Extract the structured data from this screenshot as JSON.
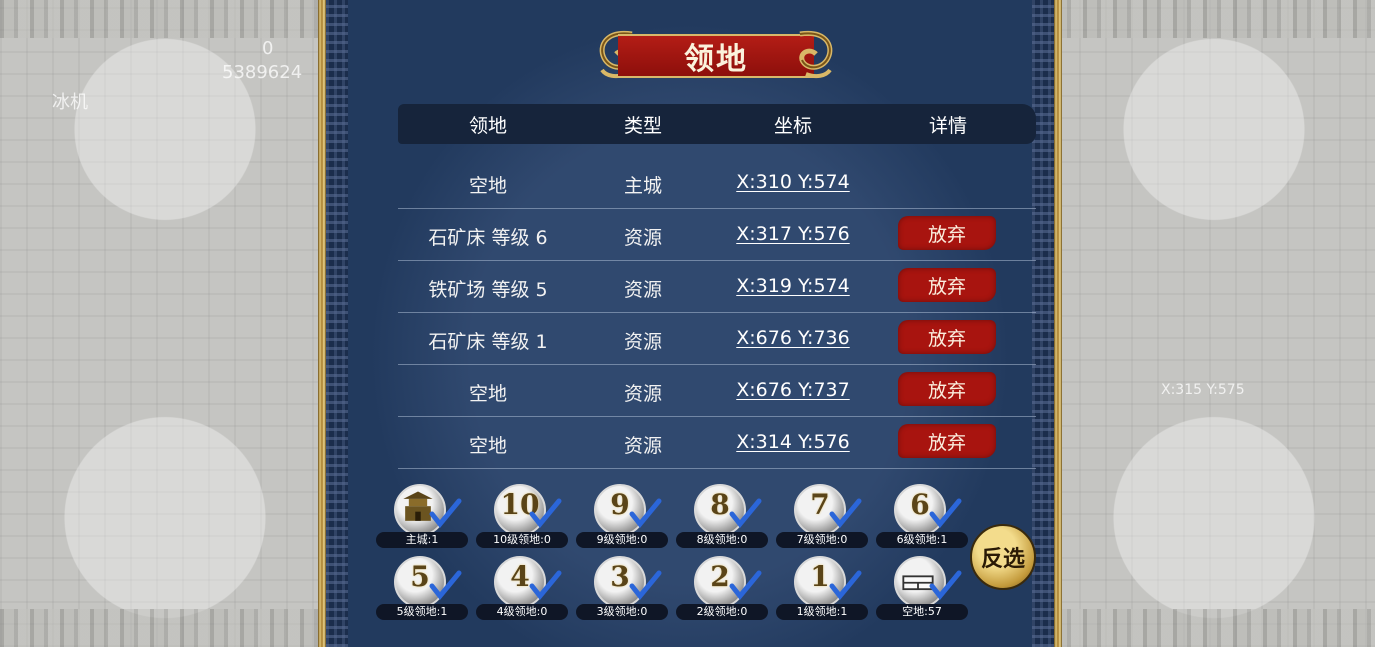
{
  "title": "领地",
  "table": {
    "headers": {
      "name": "领地",
      "type": "类型",
      "coord": "坐标",
      "detail": "详情"
    },
    "rows": [
      {
        "name": "空地",
        "type": "主城",
        "coord": "X:310 Y:574",
        "action": ""
      },
      {
        "name": "石矿床 等级 6",
        "type": "资源",
        "coord": "X:317 Y:576",
        "action": "放弃"
      },
      {
        "name": "铁矿场 等级 5",
        "type": "资源",
        "coord": "X:319 Y:574",
        "action": "放弃"
      },
      {
        "name": "石矿床 等级 1",
        "type": "资源",
        "coord": "X:676 Y:736",
        "action": "放弃"
      },
      {
        "name": "空地",
        "type": "资源",
        "coord": "X:676 Y:737",
        "action": "放弃"
      },
      {
        "name": "空地",
        "type": "资源",
        "coord": "X:314 Y:576",
        "action": "放弃"
      }
    ]
  },
  "filters": [
    {
      "icon": "main-city-icon",
      "num": "",
      "label": "主城:1",
      "checked": true
    },
    {
      "icon": "level-10-icon",
      "num": "10",
      "label": "10级领地:0",
      "checked": true
    },
    {
      "icon": "level-9-icon",
      "num": "9",
      "label": "9级领地:0",
      "checked": true
    },
    {
      "icon": "level-8-icon",
      "num": "8",
      "label": "8级领地:0",
      "checked": true
    },
    {
      "icon": "level-7-icon",
      "num": "7",
      "label": "7级领地:0",
      "checked": true
    },
    {
      "icon": "level-6-icon",
      "num": "6",
      "label": "6级领地:1",
      "checked": true
    },
    {
      "icon": "level-5-icon",
      "num": "5",
      "label": "5级领地:1",
      "checked": true
    },
    {
      "icon": "level-4-icon",
      "num": "4",
      "label": "4级领地:0",
      "checked": true
    },
    {
      "icon": "level-3-icon",
      "num": "3",
      "label": "3级领地:0",
      "checked": true
    },
    {
      "icon": "level-2-icon",
      "num": "2",
      "label": "2级领地:0",
      "checked": true
    },
    {
      "icon": "level-1-icon",
      "num": "1",
      "label": "1级领地:1",
      "checked": true
    },
    {
      "icon": "empty-land-icon",
      "num": "",
      "label": "空地:57",
      "checked": true
    }
  ],
  "reverse_label": "反选",
  "background": {
    "left_top_text": "0",
    "left_number": "5389624",
    "left_name": "冰机",
    "right_coord": "X:315 Y:575"
  },
  "colors": {
    "panel_bg": "#223a5e",
    "header_bg": "#16243b",
    "banner_red": "#a8140f",
    "gold": "#d8b86a"
  }
}
